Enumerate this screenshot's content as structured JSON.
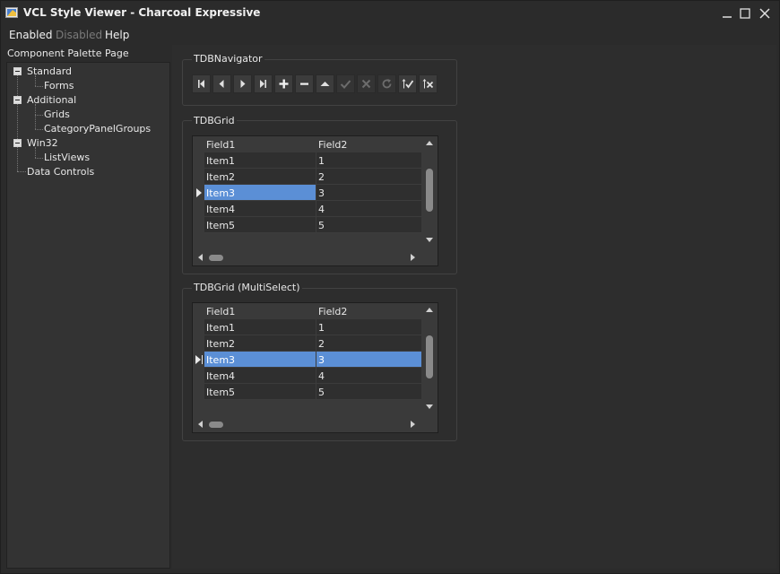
{
  "window": {
    "title": "VCL Style Viewer - Charcoal Expressive",
    "icon": "app-icon",
    "controls": [
      "minimize-icon",
      "maximize-icon",
      "close-icon"
    ]
  },
  "menu": [
    {
      "label": "Enabled",
      "enabled": true
    },
    {
      "label": "Disabled",
      "enabled": false
    },
    {
      "label": "Help",
      "enabled": true
    }
  ],
  "sidebar": {
    "label": "Component Palette Page",
    "tree": [
      {
        "label": "Standard",
        "children": [
          "Forms"
        ]
      },
      {
        "label": "Additional",
        "children": [
          "Grids",
          "CategoryPanelGroups"
        ]
      },
      {
        "label": "Win32",
        "children": [
          "ListViews"
        ]
      },
      {
        "label": "Data Controls",
        "children": []
      }
    ]
  },
  "navigator": {
    "group_title": "TDBNavigator",
    "buttons": [
      {
        "icon": "first-record-icon",
        "enabled": true
      },
      {
        "icon": "prior-record-icon",
        "enabled": true
      },
      {
        "icon": "next-record-icon",
        "enabled": true
      },
      {
        "icon": "last-record-icon",
        "enabled": true
      },
      {
        "icon": "insert-icon",
        "enabled": true
      },
      {
        "icon": "delete-icon",
        "enabled": true
      },
      {
        "icon": "edit-icon",
        "enabled": true
      },
      {
        "icon": "post-icon",
        "enabled": false
      },
      {
        "icon": "cancel-icon",
        "enabled": false
      },
      {
        "icon": "refresh-icon",
        "enabled": false
      },
      {
        "icon": "apply-updates-icon",
        "enabled": true
      },
      {
        "icon": "cancel-updates-icon",
        "enabled": true
      }
    ]
  },
  "grid1": {
    "group_title": "TDBGrid",
    "columns": [
      "Field1",
      "Field2"
    ],
    "rows": [
      [
        "Item1",
        "1"
      ],
      [
        "Item2",
        "2"
      ],
      [
        "Item3",
        "3"
      ],
      [
        "Item4",
        "4"
      ],
      [
        "Item5",
        "5"
      ]
    ],
    "selected_row": 2,
    "multiselect": false
  },
  "grid2": {
    "group_title": "TDBGrid (MultiSelect)",
    "columns": [
      "Field1",
      "Field2"
    ],
    "rows": [
      [
        "Item1",
        "1"
      ],
      [
        "Item2",
        "2"
      ],
      [
        "Item3",
        "3"
      ],
      [
        "Item4",
        "4"
      ],
      [
        "Item5",
        "5"
      ]
    ],
    "selected_row": 2,
    "multiselect": true
  },
  "colors": {
    "selection": "#5b8fd6",
    "background": "#2b2b2b",
    "disabled_text": "#7a7a7a"
  }
}
